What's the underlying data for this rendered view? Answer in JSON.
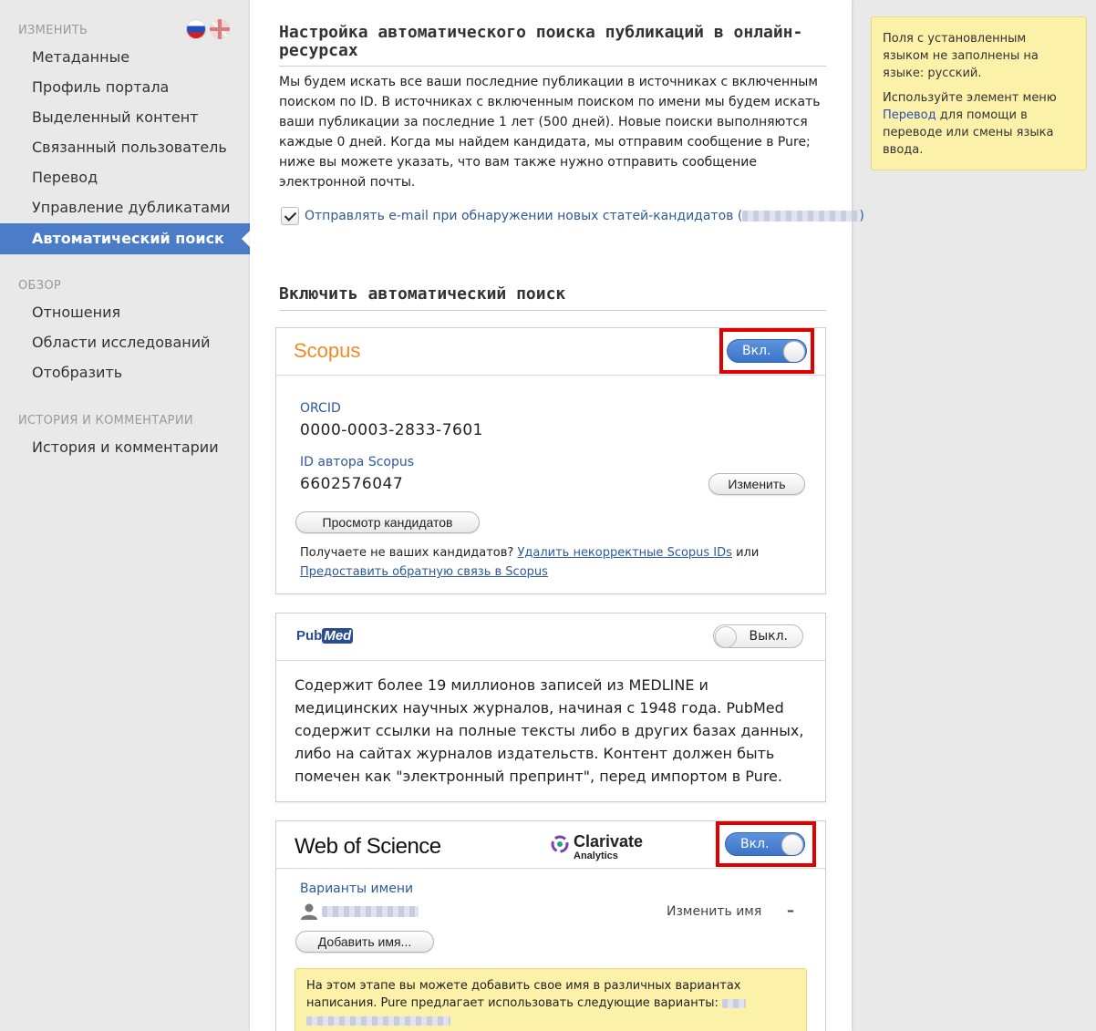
{
  "sidebar": {
    "edit_heading": "ИЗМЕНИТЬ",
    "edit_items": [
      {
        "label": "Метаданные"
      },
      {
        "label": "Профиль портала"
      },
      {
        "label": "Выделенный контент"
      },
      {
        "label": "Связанный пользователь"
      },
      {
        "label": "Перевод"
      },
      {
        "label": "Управление дубликатами"
      }
    ],
    "active_item": "Автоматический поиск",
    "overview_heading": "ОБЗОР",
    "overview_items": [
      {
        "label": "Отношения"
      },
      {
        "label": "Области исследований"
      },
      {
        "label": "Отобразить"
      }
    ],
    "history_heading": "ИСТОРИЯ И КОММЕНТАРИИ",
    "history_items": [
      {
        "label": "История и комментарии"
      }
    ]
  },
  "main": {
    "settings_title": "Настройка автоматического поиска публикаций в онлайн-ресурсах",
    "intro_text": "Мы будем искать все ваши последние публикации в источниках с включенным поиском по ID. В источниках с включенным поиском по имени мы будем искать ваши публикации за последние 1 лет (500 дней). Новые поиски выполняются каждые 0 дней. Когда мы найдем кандидата, мы отправим сообщение в Pure; ниже вы можете указать, что вам также нужно отправить сообщение электронной почты.",
    "email_checkbox_label": "Отправлять e-mail при обнаружении новых статей-кандидатов (",
    "email_checkbox_suffix": ")",
    "enable_title": "Включить автоматический поиск",
    "scopus": {
      "logo": "Scopus",
      "toggle": "Вкл.",
      "orcid_label": "ORCID",
      "orcid_value": "0000-0003-2833-7601",
      "author_id_label": "ID автора Scopus",
      "author_id_value": "6602576047",
      "edit_button": "Изменить",
      "candidates_button": "Просмотр кандидатов",
      "feedback_prefix": "Получаете не ваших кандидатов? ",
      "remove_ids_link": "Удалить некорректные Scopus IDs",
      "feedback_mid": " или",
      "feedback_link": "Предоставить обратную связь в Scopus"
    },
    "pubmed": {
      "logo_pub": "Pub",
      "logo_med": "Med",
      "toggle": "Выкл.",
      "description": "Содержит более 19 миллионов записей из MEDLINE и медицинских научных журналов, начиная с 1948 года. PubMed содержит ссылки на полные тексты либо в других базах данных, либо на сайтах журналов издательств. Контент должен быть помечен как \"электронный препринт\", перед импортом в Pure."
    },
    "wos": {
      "logo": "Web of Science",
      "clarivate": "Clarivate",
      "clarivate_sub": "Analytics",
      "toggle": "Вкл.",
      "name_variants_label": "Варианты имени",
      "change_name_link": "Изменить имя",
      "remove_symbol": "–",
      "add_name_button": "Добавить имя...",
      "hint_text": "На этом этапе вы можете добавить свое имя в различных вариантах написания. Pure предлагает использовать следующие варианты:"
    }
  },
  "info_box": {
    "line1": "Поля с установленным языком не заполнены на языке: русский.",
    "line2_prefix": "Используйте элемент меню ",
    "line2_link": "Перевод",
    "line2_suffix": " для помощи в переводе или смены языка ввода."
  },
  "colors": {
    "accent_blue": "#4a7cc7",
    "link_blue": "#2d5a9a",
    "highlight_red": "#e00000",
    "note_yellow": "#fbf1a9",
    "scopus_orange": "#f08a24"
  }
}
